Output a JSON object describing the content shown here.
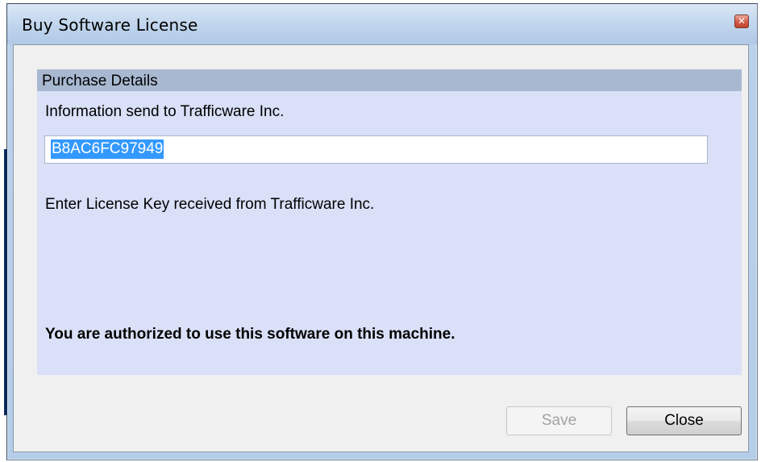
{
  "window": {
    "title": "Buy Software License",
    "close_glyph": "✕"
  },
  "panel": {
    "header": "Purchase Details",
    "info_label": "Information send to Trafficware Inc.",
    "hardware_id": "B8AC6FC97949",
    "license_label": "Enter License Key received from Trafficware Inc.",
    "status_message": "You are authorized to use this software on this machine."
  },
  "buttons": {
    "save_label": "Save",
    "save_enabled": false,
    "close_label": "Close"
  },
  "colors": {
    "panel_background": "#d9e0f7",
    "panel_header": "#a8b8d1",
    "selection": "#3399ff"
  }
}
